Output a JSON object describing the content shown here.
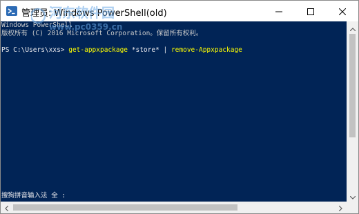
{
  "window": {
    "title": "管理员: Windows PowerShell(old)"
  },
  "console": {
    "lines": [
      "Windows PowerShell",
      "版权所有 (C) 2016 Microsoft Corporation。保留所有权利。"
    ],
    "prompt": "PS C:\\Users\\xxs> ",
    "command": "get-appxpackage",
    "argument": " *store* | ",
    "command2": "remove-Appxpackage",
    "ime_status": "搜狗拼音输入法 全 :"
  },
  "watermark": {
    "text_top": "河东软件园",
    "text_bottom": "www.pc0359.cn"
  },
  "colors": {
    "console_bg": "#012456",
    "command": "#ffff00",
    "text": "#eeedf0"
  },
  "icons": {
    "app": "powershell-icon",
    "minimize": "minimize-icon",
    "maximize": "maximize-icon",
    "close": "close-icon"
  }
}
